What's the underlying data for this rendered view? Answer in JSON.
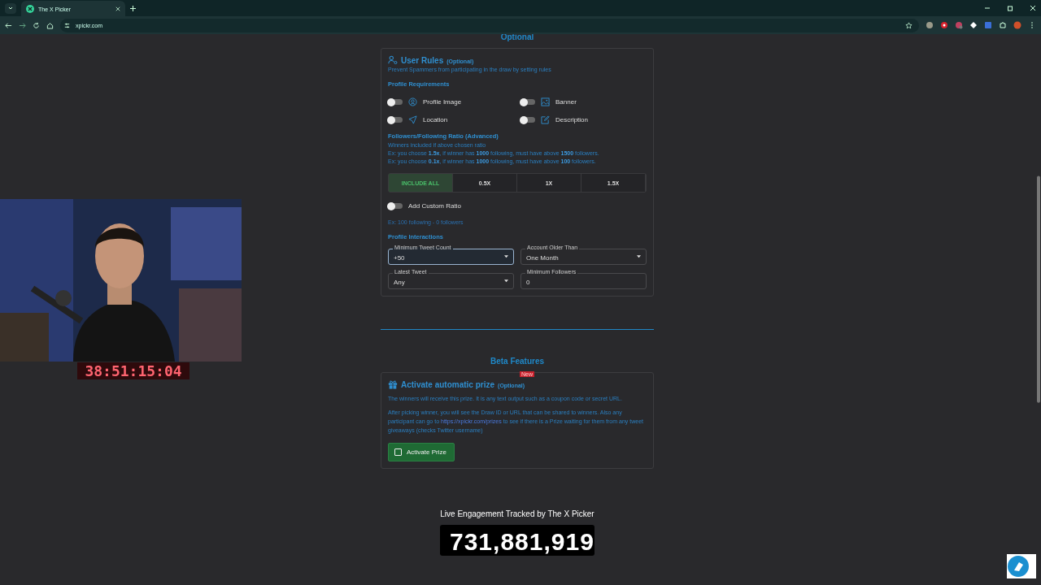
{
  "browser": {
    "tab_title": "The X Picker",
    "url": "xpickr.com"
  },
  "webcam": {
    "kind": "picture",
    "timer": "38:51:15:04"
  },
  "section_heading": "Optional",
  "user_rules": {
    "title": "User Rules",
    "title_note": "(Optional)",
    "subtitle": "Prevent Spammers from participating in the draw by setting rules",
    "requirements_heading": "Profile Requirements",
    "toggles": [
      {
        "label": "Profile Image",
        "on": false
      },
      {
        "label": "Banner",
        "on": false
      },
      {
        "label": "Location",
        "on": false
      },
      {
        "label": "Description",
        "on": false
      }
    ],
    "ratio_heading": "Followers/Following Ratio (Advanced)",
    "ratio_notes": [
      "Winners included if above chosen ratio",
      "Ex: you choose **1.5x**, if winner has **1000** following, must have above **1500** followers.",
      "Ex: you choose **0.1x**, if winner has **1000** following, must have above **100** followers."
    ],
    "ratio_options": [
      {
        "label": "INCLUDE ALL",
        "selected": true
      },
      {
        "label": "0.5X",
        "selected": false
      },
      {
        "label": "1X",
        "selected": false
      },
      {
        "label": "1.5X",
        "selected": false
      }
    ],
    "custom_ratio": {
      "label": "Add Custom Ratio",
      "on": false
    },
    "custom_example": "Ex: 100 following - 0 followers",
    "interactions_heading": "Profile Interactions",
    "fields": [
      {
        "kind": "select",
        "label": "Minimum Tweet Count",
        "value": "+50",
        "focused": true
      },
      {
        "kind": "select",
        "label": "Account Older Than",
        "value": "One Month",
        "focused": false
      },
      {
        "kind": "select",
        "label": "Latest Tweet",
        "value": "Any",
        "focused": false
      },
      {
        "kind": "input",
        "label": "Minimum Followers",
        "value": "0",
        "focused": false
      }
    ]
  },
  "beta_heading": "Beta Features",
  "prize": {
    "title": "Activate automatic prize",
    "title_note": "(Optional)",
    "badge": "New",
    "description": "The winners will receive this prize. It is any text output such as a coupon code or secret URL.",
    "info_before": "After picking winner, you will see the Draw ID or URL that can be shared to winners. Also any participant can go to ",
    "info_link": "https://xpickr.com/prizes",
    "info_after": " to see if there is a Prize waiting for them from any tweet giveaways (checks Twitter username)",
    "button": {
      "label": "Activate Prize",
      "checked": false
    }
  },
  "live": {
    "label": "Live Engagement Tracked by The X Picker",
    "counter": "731,881,919"
  }
}
